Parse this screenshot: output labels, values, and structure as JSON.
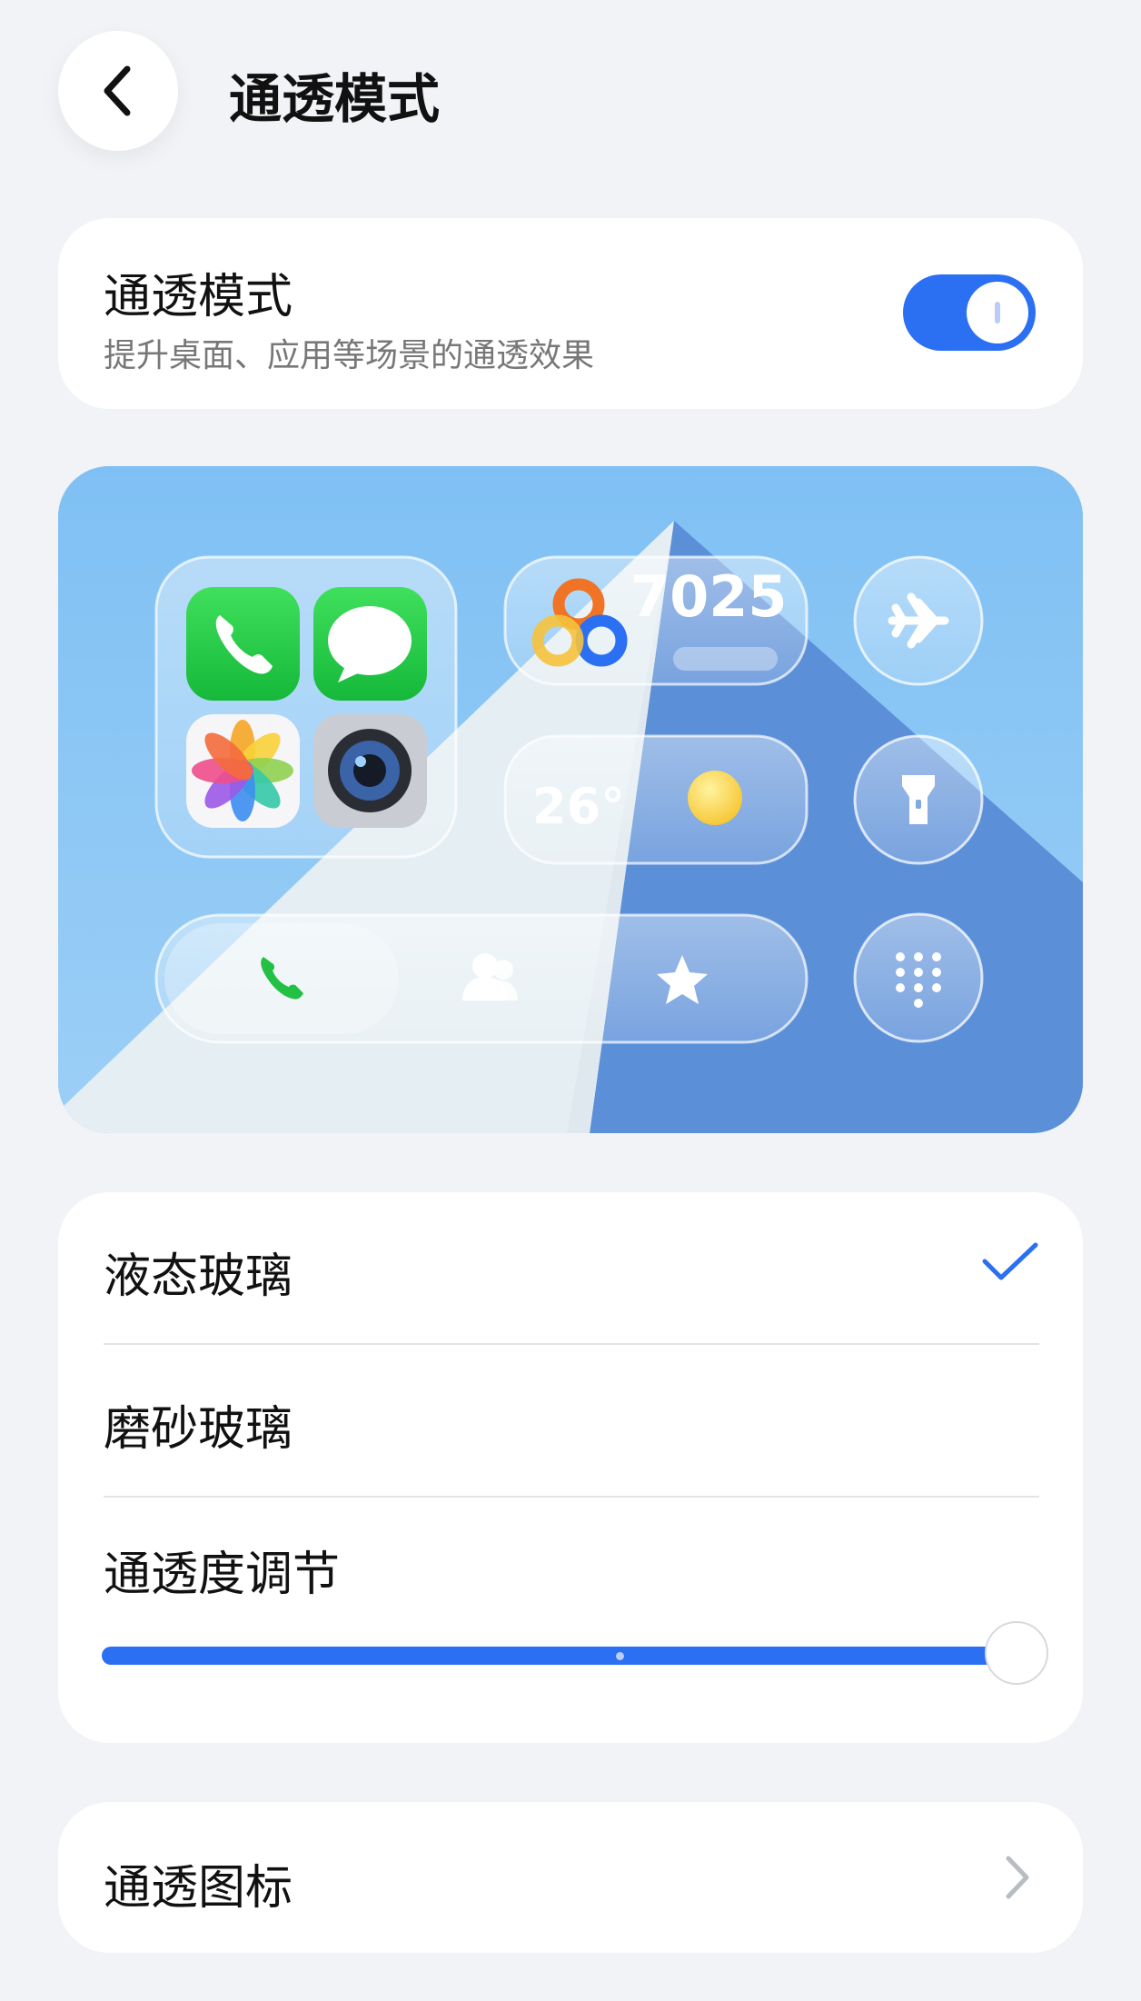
{
  "header": {
    "title": "通透模式"
  },
  "toggle_card": {
    "title": "通透模式",
    "subtitle": "提升桌面、应用等场景的通透效果",
    "enabled": true
  },
  "preview": {
    "steps_count": "7025",
    "temperature": "26°"
  },
  "options": {
    "liquid_glass": "液态玻璃",
    "frosted_glass": "磨砂玻璃",
    "selected": "液态玻璃",
    "transparency_label": "通透度调节",
    "transparency_value": 1.0
  },
  "icons_row": {
    "label": "通透图标"
  },
  "colors": {
    "accent": "#2b6ff2",
    "background": "#f1f3f6"
  }
}
